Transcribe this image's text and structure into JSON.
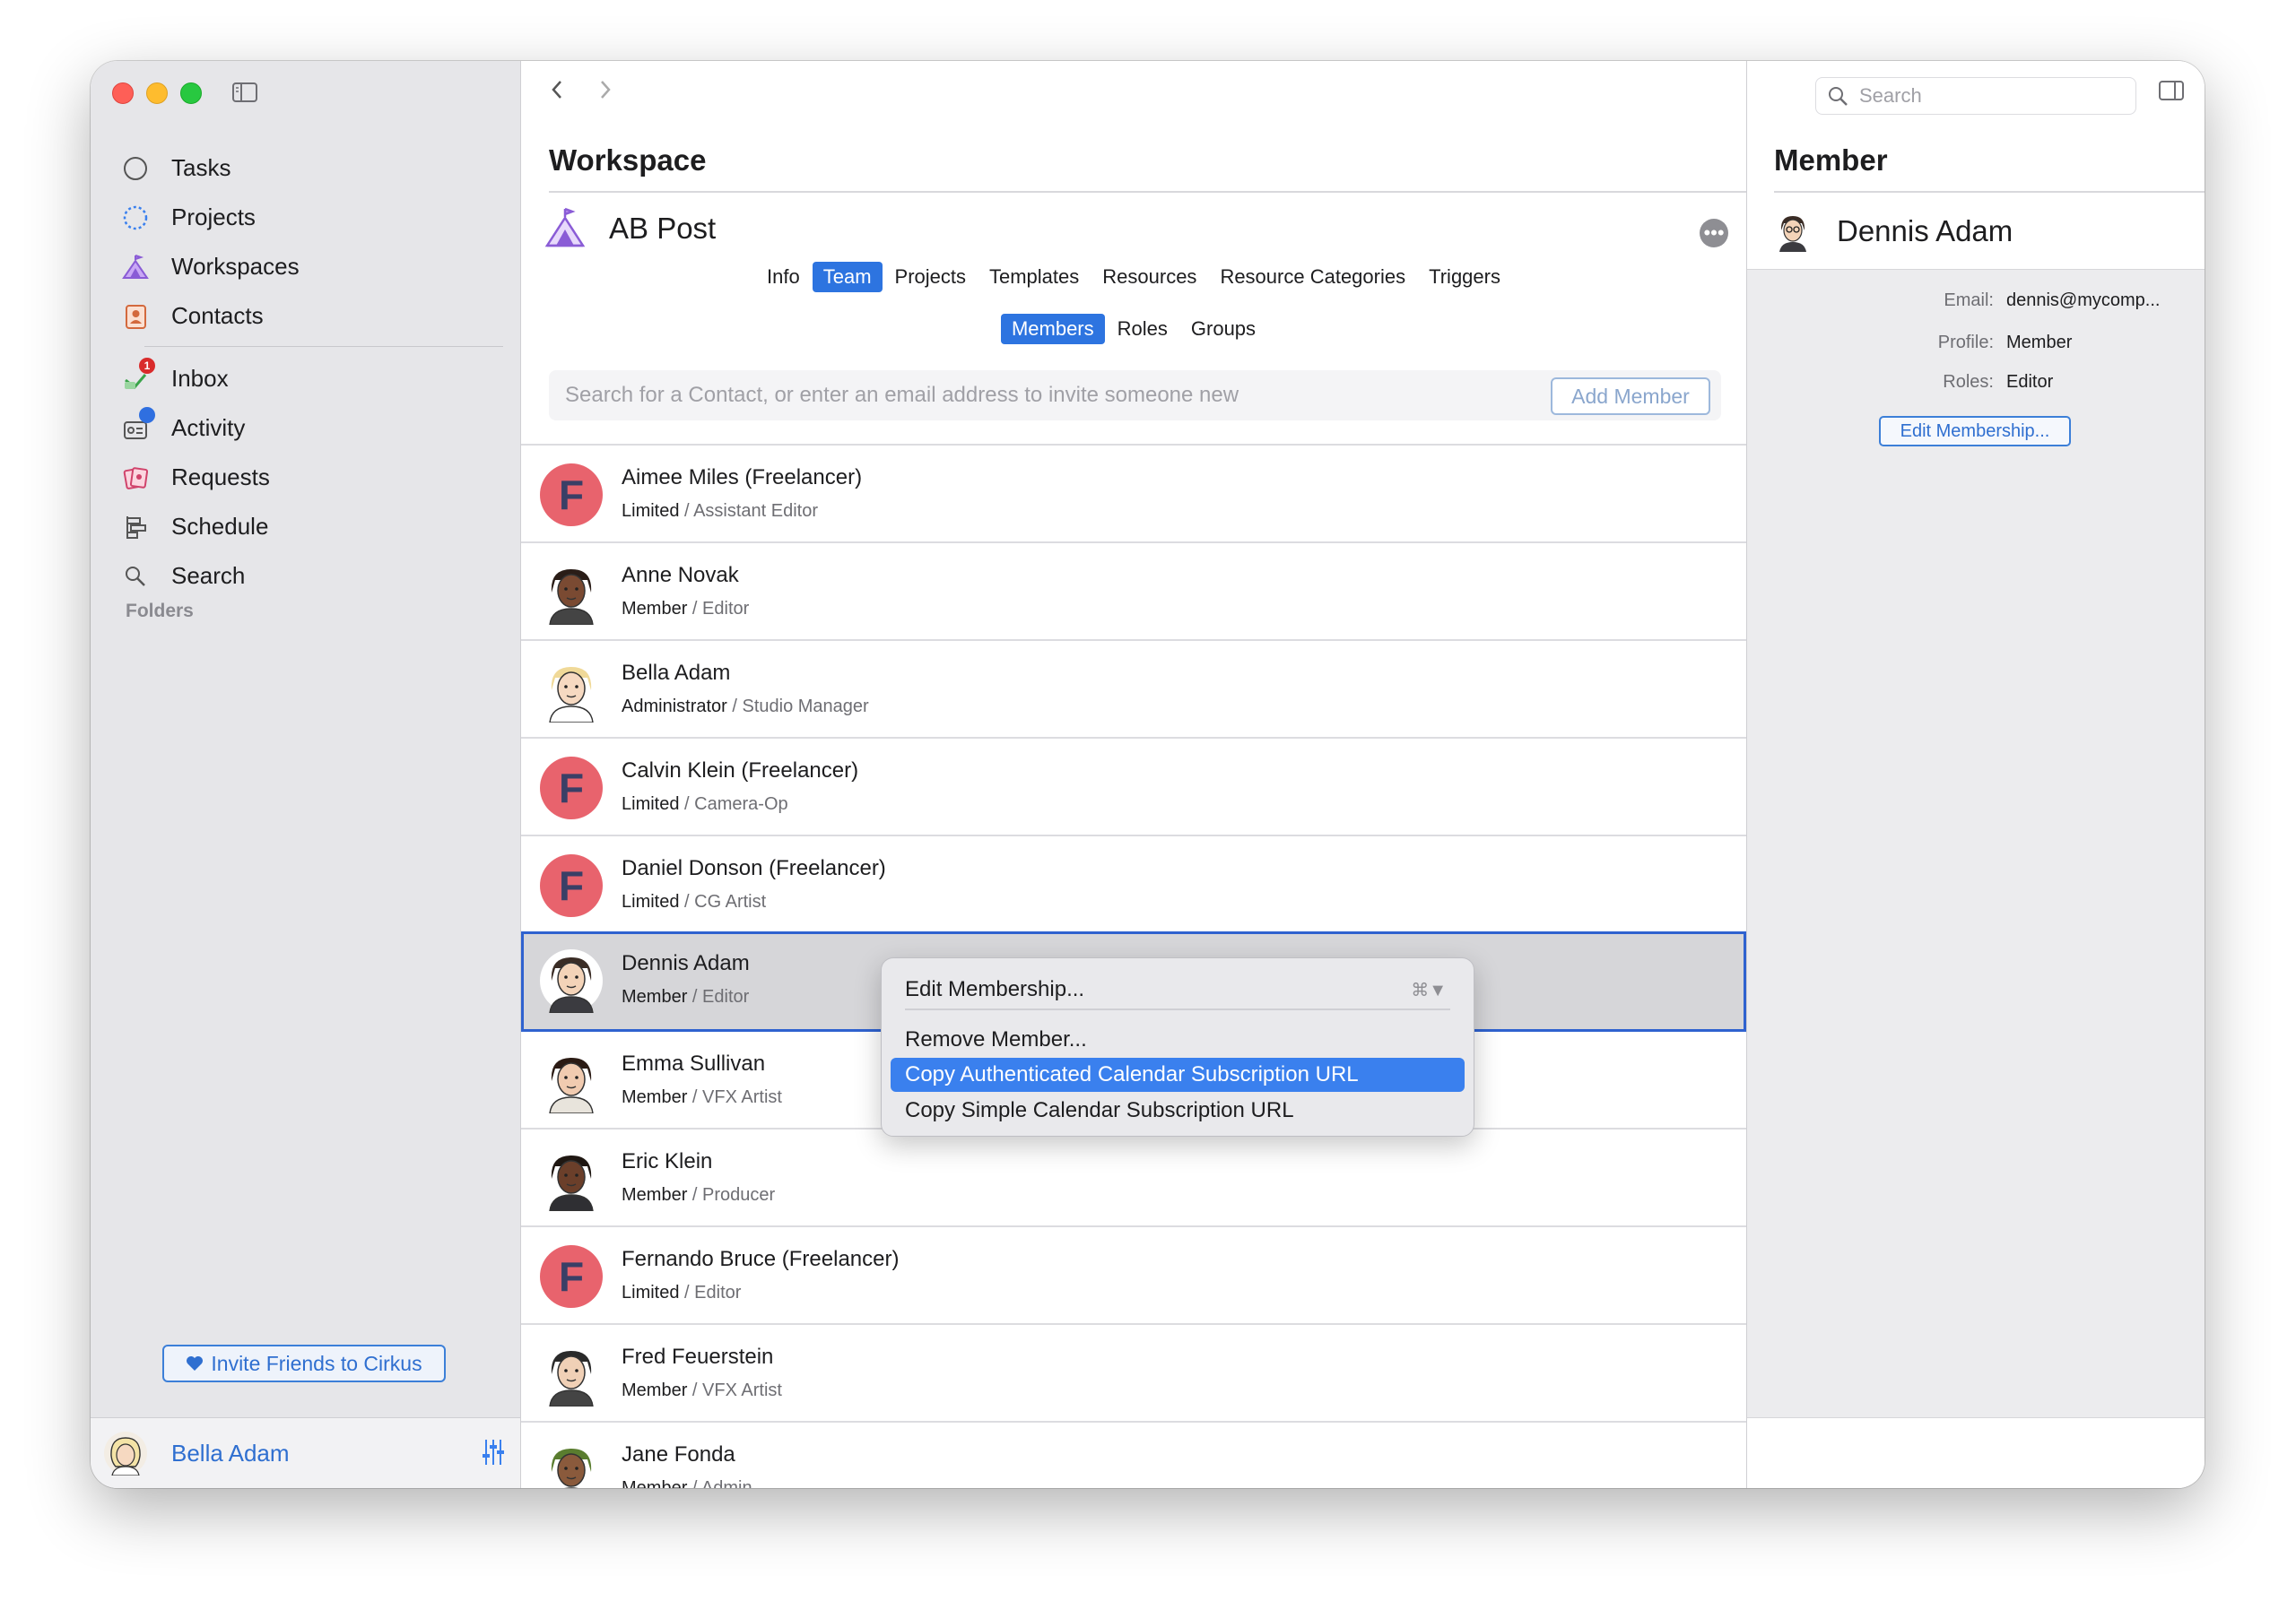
{
  "sidebar": {
    "items": [
      {
        "label": "Tasks",
        "icon": "circle-icon"
      },
      {
        "label": "Projects",
        "icon": "dotted-circle-icon"
      },
      {
        "label": "Workspaces",
        "icon": "tent-icon"
      },
      {
        "label": "Contacts",
        "icon": "contact-book-icon"
      },
      {
        "label": "Inbox",
        "icon": "inbox-icon",
        "badge": "1"
      },
      {
        "label": "Activity",
        "icon": "activity-icon"
      },
      {
        "label": "Requests",
        "icon": "requests-icon"
      },
      {
        "label": "Schedule",
        "icon": "schedule-icon"
      },
      {
        "label": "Search",
        "icon": "search-icon"
      }
    ],
    "folders_label": "Folders",
    "invite_label": "Invite Friends to Cirkus",
    "user_name": "Bella Adam"
  },
  "main": {
    "title": "Workspace",
    "workspace_name": "AB Post",
    "more_glyph": "•••",
    "tabs": [
      "Info",
      "Team",
      "Projects",
      "Templates",
      "Resources",
      "Resource Categories",
      "Triggers"
    ],
    "active_tab": "Team",
    "subtabs": [
      "Members",
      "Roles",
      "Groups"
    ],
    "active_subtab": "Members",
    "search_placeholder": "Search for a Contact, or enter an email address to invite someone new",
    "add_member_label": "Add Member",
    "members": [
      {
        "name": "Aimee Miles (Freelancer)",
        "profile": "Limited",
        "role": "Assistant Editor",
        "avatar": "freelancer"
      },
      {
        "name": "Anne Novak",
        "profile": "Member",
        "role": "Editor",
        "avatar": "person"
      },
      {
        "name": "Bella Adam",
        "profile": "Administrator",
        "role": "Studio Manager",
        "avatar": "person"
      },
      {
        "name": "Calvin Klein (Freelancer)",
        "profile": "Limited",
        "role": "Camera-Op",
        "avatar": "freelancer"
      },
      {
        "name": "Daniel Donson (Freelancer)",
        "profile": "Limited",
        "role": "CG Artist",
        "avatar": "freelancer"
      },
      {
        "name": "Dennis Adam",
        "profile": "Member",
        "role": "Editor",
        "avatar": "person",
        "selected": true
      },
      {
        "name": "Emma Sullivan",
        "profile": "Member",
        "role": "VFX Artist",
        "avatar": "person"
      },
      {
        "name": "Eric Klein",
        "profile": "Member",
        "role": "Producer",
        "avatar": "person"
      },
      {
        "name": "Fernando Bruce (Freelancer)",
        "profile": "Limited",
        "role": "Editor",
        "avatar": "freelancer"
      },
      {
        "name": "Fred Feuerstein",
        "profile": "Member",
        "role": "VFX Artist",
        "avatar": "person"
      },
      {
        "name": "Jane Fonda",
        "profile": "Member",
        "role": "Admin",
        "avatar": "person"
      }
    ],
    "freelancer_letter": "F",
    "role_separator": " / "
  },
  "context_menu": {
    "items": [
      {
        "label": "Edit Membership...",
        "shortcut": "⌘▼"
      },
      {
        "label": "Remove Member..."
      },
      {
        "label": "Copy Authenticated Calendar Subscription URL",
        "highlighted": true
      },
      {
        "label": "Copy Simple Calendar Subscription URL"
      }
    ]
  },
  "inspector": {
    "search_placeholder": "Search",
    "title": "Member",
    "person_name": "Dennis Adam",
    "details": [
      {
        "key": "Email:",
        "value": "dennis@mycomp..."
      },
      {
        "key": "Profile:",
        "value": "Member"
      },
      {
        "key": "Roles:",
        "value": "Editor"
      }
    ],
    "edit_button": "Edit Membership..."
  },
  "colors": {
    "accent": "#2d74e0",
    "freelancer_avatar": "#e8636d",
    "sidebar_bg": "#e6e6e9",
    "selection_border": "#2f62cf"
  }
}
